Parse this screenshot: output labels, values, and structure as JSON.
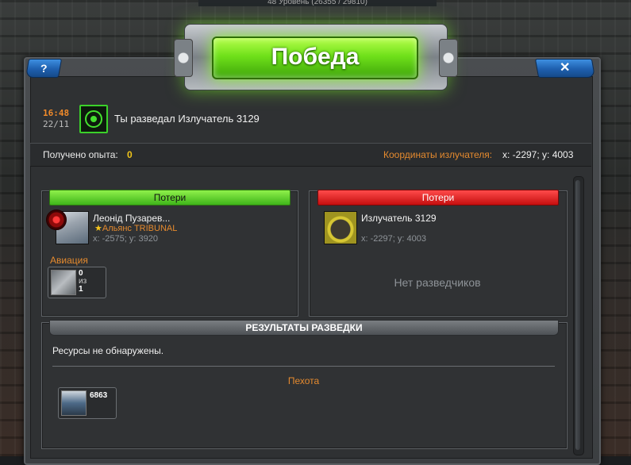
{
  "top_strip": "48 Уровень (26355 / 29810)",
  "banner": {
    "title": "Победа"
  },
  "buttons": {
    "help": "?",
    "close": "✕"
  },
  "event": {
    "time": "16:48",
    "date": "22/11",
    "text": "Ты разведал Излучатель 3129",
    "icon": "radar-icon"
  },
  "experience": {
    "label": "Получено опыта:",
    "value": "0"
  },
  "coordinates": {
    "label": "Координаты излучателя:",
    "value": "x: -2297; y: 4003"
  },
  "attacker": {
    "header": "Потери",
    "header_color": "#4fc21f",
    "name": "Леонід Пузарев...",
    "alliance": "Альянс TRIBUNAL",
    "coords": "x: -2575; y: 3920",
    "category": "Aвиация",
    "unit": {
      "top": "0",
      "mid": "из",
      "bottom": "1"
    }
  },
  "defender": {
    "header": "Потери",
    "header_color": "#d81a1a",
    "name": "Излучатель 3129",
    "coords": "x: -2297; y: 4003",
    "empty": "Нет разведчиков"
  },
  "results": {
    "header": "РЕЗУЛЬТАТЫ РАЗВЕДКИ",
    "resources": "Ресурсы не обнаружены.",
    "category": "Пехота",
    "unit_count": "6863"
  }
}
